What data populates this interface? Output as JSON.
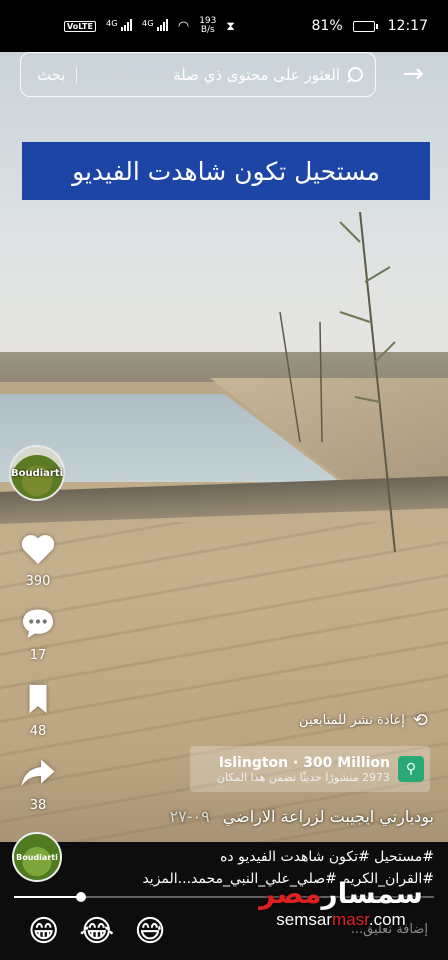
{
  "status_bar": {
    "network_label": "VoLTE",
    "sim1_gen": "4G",
    "sim2_gen": "4G",
    "speed_value": "193",
    "speed_unit": "B/s",
    "battery": "81%",
    "time": "12:17",
    "battery_level": 0.81
  },
  "search": {
    "placeholder": "العثور على محتوى ذي صلة",
    "button_label": "بحث"
  },
  "banner": {
    "text": "مستحيل تكون شاهدت الفيديو"
  },
  "channel": {
    "avatar_label": "Boudiarti"
  },
  "actions": {
    "likes": "390",
    "comments": "17",
    "saves": "48",
    "shares": "38"
  },
  "repost": {
    "label": "إعادة نشر للمتابعين"
  },
  "location": {
    "title": "Islington · 300 Million",
    "subtitle": "2973 منشورًا حديثًا تضمن هذا المكان"
  },
  "video": {
    "title": "بوديارتي ايجيبت لزراعة الاراضي",
    "date": "٠٩-٢٧"
  },
  "caption": {
    "line1": "#مستحيل #تكون شاهدت الفيديو ده",
    "line2": "#القران_الكريم #صلي_علي_النبي_محمد...المزيد"
  },
  "progress": 0.16,
  "emojis": [
    "😁",
    "😂",
    "😅"
  ],
  "comment_placeholder": "إضافة تعليق...",
  "watermark": {
    "arabic_main": "سمسار",
    "arabic_red": "مصر",
    "url_main": "semsar",
    "url_red": "masr",
    "url_tld": ".com"
  }
}
